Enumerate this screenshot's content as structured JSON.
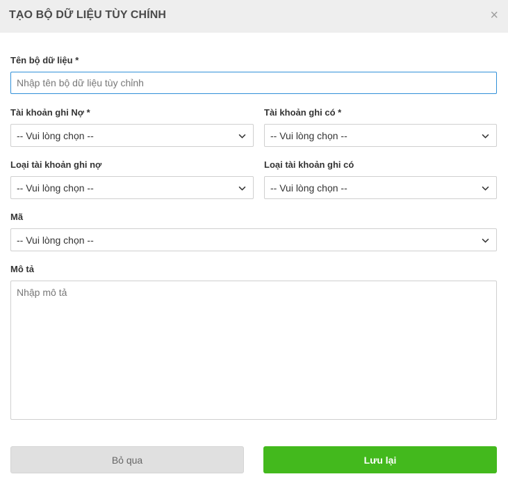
{
  "dialog": {
    "title": "TẠO BỘ DỮ LIỆU TÙY CHÍNH",
    "close_symbol": "×"
  },
  "form": {
    "dataset_name": {
      "label": "Tên bộ dữ liệu *",
      "placeholder": "Nhập tên bộ dữ liệu tùy chỉnh",
      "value": ""
    },
    "debit_account": {
      "label": "Tài khoản ghi Nợ *",
      "value": "-- Vui lòng chọn --"
    },
    "credit_account": {
      "label": "Tài khoản ghi có *",
      "value": "-- Vui lòng chọn --"
    },
    "debit_account_type": {
      "label": "Loại tài khoản ghi nợ",
      "value": "-- Vui lòng chọn --"
    },
    "credit_account_type": {
      "label": "Loại tài khoản ghi có",
      "value": "-- Vui lòng chọn --"
    },
    "code": {
      "label": "Mã",
      "value": "-- Vui lòng chọn --"
    },
    "description": {
      "label": "Mô tả",
      "placeholder": "Nhập mô tả",
      "value": ""
    }
  },
  "actions": {
    "cancel_label": "Bỏ qua",
    "save_label": "Lưu lại"
  },
  "colors": {
    "header_bg": "#eeeeee",
    "focus_border": "#2f8fd8",
    "save_bg": "#43b91d",
    "cancel_bg": "#e0e0e0"
  }
}
